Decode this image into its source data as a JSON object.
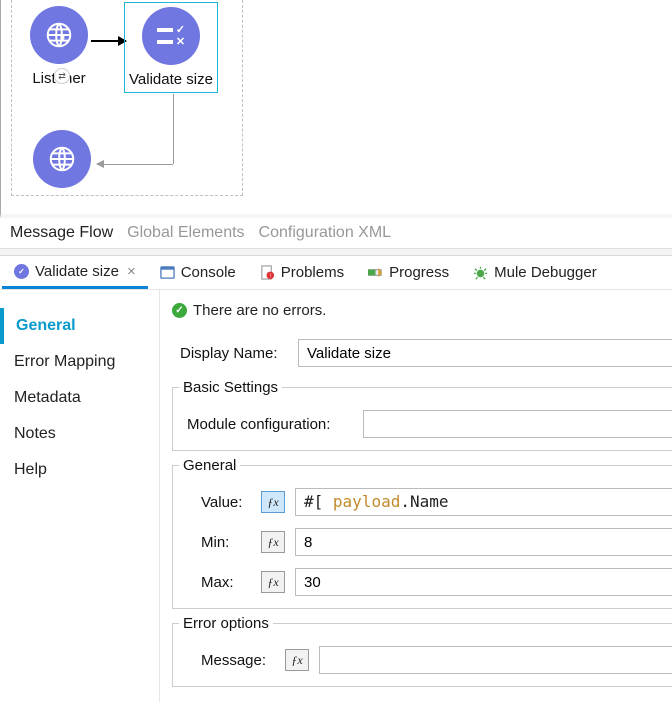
{
  "canvas": {
    "nodes": {
      "listener": {
        "label": "Listener"
      },
      "validate": {
        "label": "Validate size"
      },
      "outbound": {
        "label": ""
      }
    }
  },
  "flow_tabs": {
    "message_flow": "Message Flow",
    "global_elements": "Global Elements",
    "configuration_xml": "Configuration XML"
  },
  "panel_tabs": {
    "validate": "Validate size",
    "console": "Console",
    "problems": "Problems",
    "progress": "Progress",
    "mule_debugger": "Mule Debugger"
  },
  "sidebar": {
    "items": [
      "General",
      "Error Mapping",
      "Metadata",
      "Notes",
      "Help"
    ]
  },
  "status": {
    "message": "There are no errors."
  },
  "form": {
    "display_name": {
      "label": "Display Name:",
      "value": "Validate size"
    },
    "basic_settings": {
      "legend": "Basic Settings",
      "module_configuration": {
        "label": "Module configuration:",
        "value": ""
      }
    },
    "general": {
      "legend": "General",
      "value": {
        "label": "Value:",
        "prefix": "#[ ",
        "payload_word": "payload",
        "suffix": ".Name"
      },
      "min": {
        "label": "Min:",
        "value": "8"
      },
      "max": {
        "label": "Max:",
        "value": "30"
      }
    },
    "error_options": {
      "legend": "Error options",
      "message": {
        "label": "Message:",
        "value": ""
      }
    }
  },
  "fx_label": "ƒx"
}
